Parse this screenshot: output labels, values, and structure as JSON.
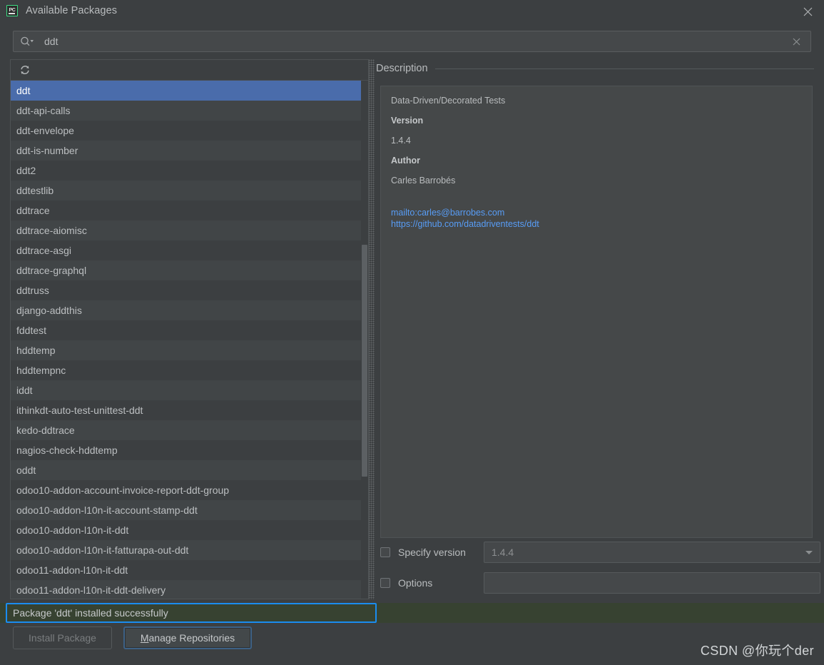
{
  "window": {
    "title": "Available Packages",
    "app_icon": "pycharm-icon",
    "close_icon": "close-icon",
    "accent_blue": "#4a6cab",
    "focus_blue": "#1a8cf0",
    "success_green_bg": "#374231",
    "link_blue": "#589df6"
  },
  "search": {
    "icon": "search-icon",
    "value": "ddt",
    "placeholder": "",
    "clear_icon": "close-icon"
  },
  "list": {
    "refresh_icon": "refresh-icon",
    "selected_index": 0,
    "items": [
      "ddt",
      "ddt-api-calls",
      "ddt-envelope",
      "ddt-is-number",
      "ddt2",
      "ddtestlib",
      "ddtrace",
      "ddtrace-aiomisc",
      "ddtrace-asgi",
      "ddtrace-graphql",
      "ddtruss",
      "django-addthis",
      "fddtest",
      "hddtemp",
      "hddtempnc",
      "iddt",
      "ithinkdt-auto-test-unittest-ddt",
      "kedo-ddtrace",
      "nagios-check-hddtemp",
      "oddt",
      "odoo10-addon-account-invoice-report-ddt-group",
      "odoo10-addon-l10n-it-account-stamp-ddt",
      "odoo10-addon-l10n-it-ddt",
      "odoo10-addon-l10n-it-fatturapa-out-ddt",
      "odoo11-addon-l10n-it-ddt",
      "odoo11-addon-l10n-it-ddt-delivery"
    ]
  },
  "description": {
    "title": "Description",
    "summary": "Data-Driven/Decorated Tests",
    "version_label": "Version",
    "version_value": "1.4.4",
    "author_label": "Author",
    "author_value": "Carles Barrobés",
    "links": [
      "mailto:carles@barrobes.com",
      "https://github.com/datadriventests/ddt"
    ]
  },
  "options": {
    "specify_version_label": "Specify version",
    "specify_version_checked": false,
    "version_value": "1.4.4",
    "options_label": "Options",
    "options_checked": false,
    "options_value": ""
  },
  "status": {
    "message": "Package 'ddt' installed successfully"
  },
  "buttons": {
    "install_label": "Install Package",
    "install_enabled": false,
    "manage_mnemonic": "M",
    "manage_rest": "anage Repositories"
  },
  "watermark": {
    "text": "CSDN @你玩个der"
  }
}
